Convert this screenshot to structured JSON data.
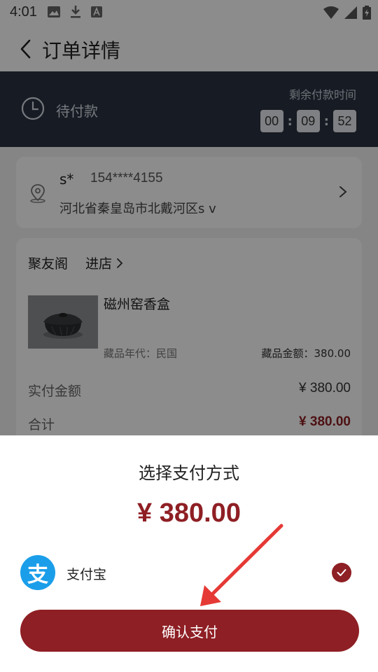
{
  "status_bar": {
    "time": "4:01"
  },
  "header": {
    "title": "订单详情"
  },
  "order_status": {
    "label": "待付款",
    "remaining_label": "剩余付款时间",
    "countdown": {
      "hh": "00",
      "mm": "09",
      "ss": "52"
    }
  },
  "address": {
    "name": "s*",
    "phone": "154****4155",
    "line": "河北省秦皇岛市北戴河区s v"
  },
  "shop": {
    "name": "聚友阁",
    "enter_label": "进店"
  },
  "product": {
    "name": "磁州窑香盒",
    "era_label": "藏品年代：民国",
    "amount_label": "藏品金额：380.00"
  },
  "summary": {
    "paid_label": "实付金额",
    "paid_value": "¥ 380.00",
    "total_label": "合计",
    "total_value": "¥ 380.00"
  },
  "payment_sheet": {
    "title": "选择支付方式",
    "amount": "¥ 380.00",
    "method_icon_glyph": "支",
    "method_label": "支付宝",
    "confirm_label": "确认支付"
  },
  "colors": {
    "brand": "#8e1f24",
    "banner": "#2a3342",
    "alipay": "#1a9eea"
  },
  "icons": [
    "image-icon",
    "download-icon",
    "font-icon",
    "wifi-icon",
    "signal-icon",
    "battery-icon",
    "back-arrow-icon",
    "clock-icon",
    "location-icon",
    "chevron-right-icon",
    "check-icon",
    "alipay-icon"
  ]
}
